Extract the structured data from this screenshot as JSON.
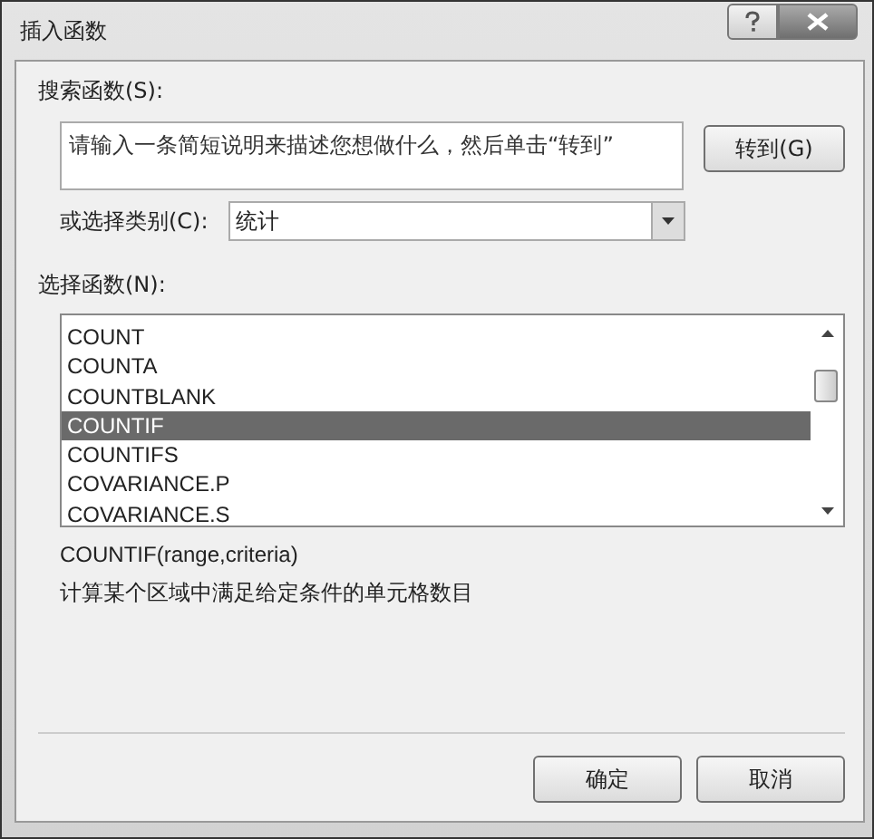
{
  "window": {
    "title": "插入函数"
  },
  "search": {
    "label": "搜索函数(S):",
    "placeholder": "请输入一条简短说明来描述您想做什么，然后单击“转到”",
    "go_button": "转到(G)"
  },
  "category": {
    "label": "或选择类别(C):",
    "value": "统计"
  },
  "functions": {
    "label": "选择函数(N):",
    "items": [
      {
        "name": "COUNT",
        "selected": false
      },
      {
        "name": "COUNTA",
        "selected": false
      },
      {
        "name": "COUNTBLANK",
        "selected": false
      },
      {
        "name": "COUNTIF",
        "selected": true
      },
      {
        "name": "COUNTIFS",
        "selected": false
      },
      {
        "name": "COVARIANCE.P",
        "selected": false
      },
      {
        "name": "COVARIANCE.S",
        "selected": false
      }
    ]
  },
  "signature": "COUNTIF(range,criteria)",
  "description": "计算某个区域中满足给定条件的单元格数目",
  "buttons": [
    "确定",
    "取消"
  ]
}
